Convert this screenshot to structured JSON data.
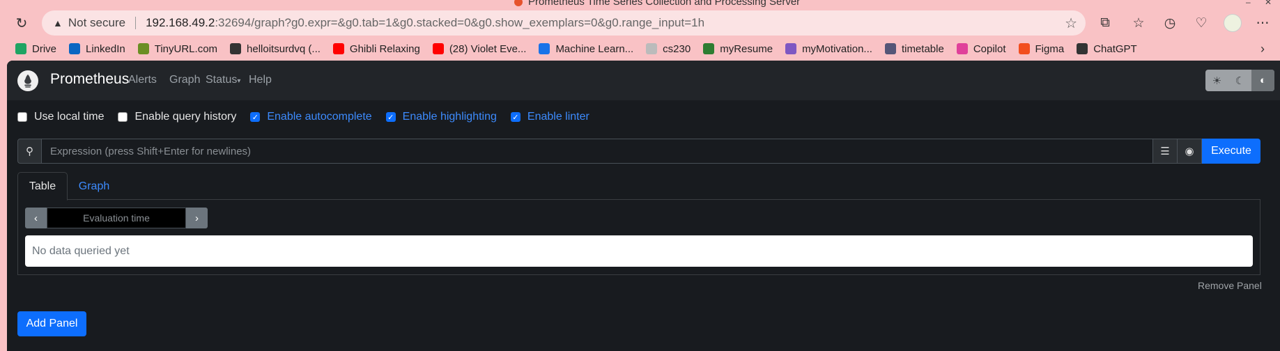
{
  "browser": {
    "tab_title": "Prometheus Time Series Collection and Processing Server",
    "not_secure": "Not secure",
    "url_host": "192.168.49.2",
    "url_path": ":32694/graph?g0.expr=&g0.tab=1&g0.stacked=0&g0.show_exemplars=0&g0.range_input=1h",
    "bookmarks": [
      {
        "label": "Drive",
        "color": "#1fa463"
      },
      {
        "label": "LinkedIn",
        "color": "#0a66c2"
      },
      {
        "label": "TinyURL.com",
        "color": "#6b8e23"
      },
      {
        "label": "helloitsurdvq (...",
        "color": "#333333"
      },
      {
        "label": "Ghibli Relaxing",
        "color": "#ff0000"
      },
      {
        "label": "(28) Violet Eve...",
        "color": "#ff0000"
      },
      {
        "label": "Machine Learn...",
        "color": "#1a73e8"
      },
      {
        "label": "cs230",
        "color": "#bbbbbb"
      },
      {
        "label": "myResume",
        "color": "#2e7d32"
      },
      {
        "label": "myMotivation...",
        "color": "#7e57c2"
      },
      {
        "label": "timetable",
        "color": "#555577"
      },
      {
        "label": "Copilot",
        "color": "#e0409a"
      },
      {
        "label": "Figma",
        "color": "#f24e1e"
      },
      {
        "label": "ChatGPT",
        "color": "#333333"
      }
    ]
  },
  "app": {
    "brand": "Prometheus",
    "nav": {
      "alerts": "Alerts",
      "graph": "Graph",
      "status": "Status",
      "help": "Help"
    },
    "options": {
      "local_time": "Use local time",
      "query_history": "Enable query history",
      "autocomplete": "Enable autocomplete",
      "highlighting": "Enable highlighting",
      "linter": "Enable linter"
    },
    "query": {
      "placeholder": "Expression (press Shift+Enter for newlines)",
      "execute": "Execute"
    },
    "tabs": {
      "table": "Table",
      "graph": "Graph"
    },
    "panel": {
      "eval_placeholder": "Evaluation time",
      "no_data": "No data queried yet",
      "remove": "Remove Panel"
    },
    "add_panel": "Add Panel"
  },
  "colors": {
    "accent": "#0d6efd",
    "background": "#181b1f",
    "navbar": "#222529",
    "chrome": "#f9c2c5"
  }
}
